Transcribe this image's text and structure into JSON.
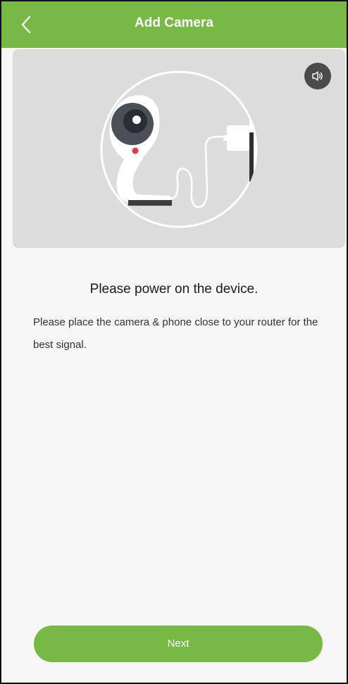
{
  "header": {
    "title": "Add Camera",
    "accent_color": "#78b844"
  },
  "illustration": {
    "background_color": "#dcdcdc",
    "icons": [
      "speaker-icon",
      "camera-illustration"
    ]
  },
  "content": {
    "heading": "Please power on the device.",
    "description": "Please place the camera  & phone close to your router for the best signal."
  },
  "actions": {
    "next_label": "Next"
  }
}
